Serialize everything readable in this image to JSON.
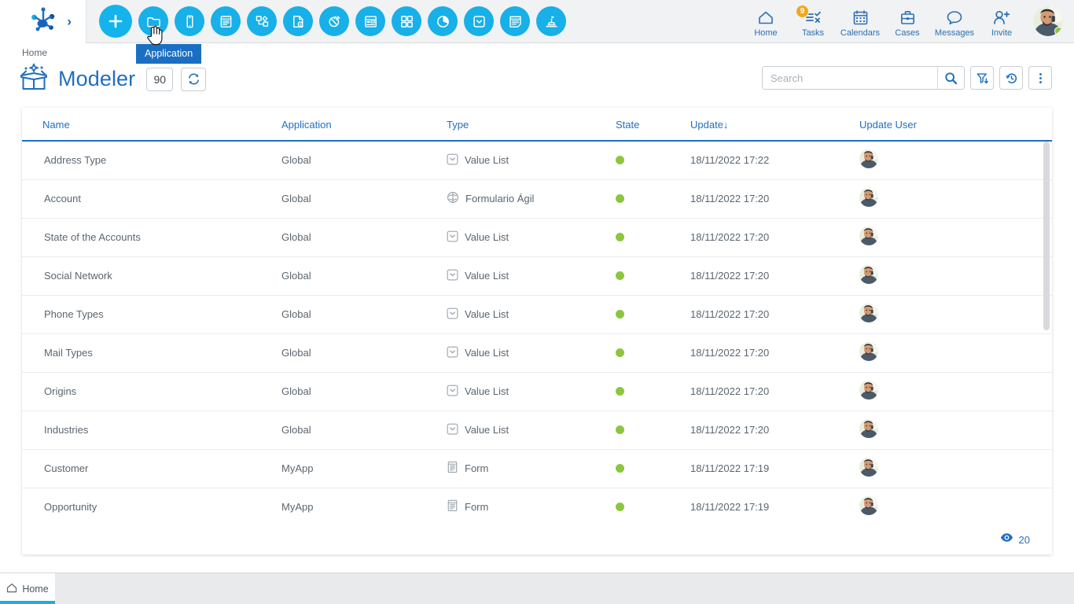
{
  "app": {
    "logo_name": "bizagi-logo",
    "expand_chevron": "›"
  },
  "toolbar": {
    "buttons": [
      {
        "name": "new-button",
        "icon": "plus-icon",
        "tooltip": "New"
      },
      {
        "name": "application-button",
        "icon": "folder-icon",
        "tooltip": "Application"
      },
      {
        "name": "mobile-button",
        "icon": "mobile-icon",
        "tooltip": "Mobile"
      },
      {
        "name": "form-button",
        "icon": "form-icon",
        "tooltip": "Form"
      },
      {
        "name": "process-button",
        "icon": "process-diagram-icon",
        "tooltip": "Process"
      },
      {
        "name": "document-template-button",
        "icon": "document-gear-icon",
        "tooltip": "Document Template"
      },
      {
        "name": "connector-button",
        "icon": "plug-icon",
        "tooltip": "Connector"
      },
      {
        "name": "layout-button",
        "icon": "page-layout-icon",
        "tooltip": "Layout"
      },
      {
        "name": "dashboard-button",
        "icon": "grid-squares-icon",
        "tooltip": "Dashboard"
      },
      {
        "name": "chart-button",
        "icon": "pie-chart-icon",
        "tooltip": "Chart"
      },
      {
        "name": "value-list-button",
        "icon": "value-list-icon",
        "tooltip": "Value List"
      },
      {
        "name": "report-button",
        "icon": "report-icon",
        "tooltip": "Report"
      },
      {
        "name": "business-rule-button",
        "icon": "rule-stamp-icon",
        "tooltip": "Business Rule"
      }
    ],
    "active_tooltip": "Application"
  },
  "topnav": {
    "items": [
      {
        "label": "Home",
        "icon": "home-icon",
        "badge": null
      },
      {
        "label": "Tasks",
        "icon": "tasks-checklist-icon",
        "badge": "9"
      },
      {
        "label": "Calendars",
        "icon": "calendar-icon",
        "badge": null
      },
      {
        "label": "Cases",
        "icon": "briefcase-icon",
        "badge": null
      },
      {
        "label": "Messages",
        "icon": "chat-bubble-icon",
        "badge": null
      },
      {
        "label": "Invite",
        "icon": "user-add-icon",
        "badge": null
      }
    ],
    "avatar_name": "user-avatar",
    "status": "online"
  },
  "page": {
    "breadcrumb": "Home",
    "title": "Modeler",
    "count": "90",
    "refresh_icon": "refresh-icon",
    "module_icon": "open-box-sparkle-icon"
  },
  "search": {
    "value": "",
    "placeholder": "Search",
    "search_icon": "magnifier-icon",
    "filter_icon": "filter-down-icon",
    "history_icon": "history-revert-icon",
    "more_icon": "kebab-menu-icon"
  },
  "table": {
    "columns": [
      {
        "key": "name",
        "label": "Name"
      },
      {
        "key": "application",
        "label": "Application"
      },
      {
        "key": "type",
        "label": "Type"
      },
      {
        "key": "state",
        "label": "State"
      },
      {
        "key": "update",
        "label": "Update",
        "sort": "↓"
      },
      {
        "key": "update_user",
        "label": "Update User"
      }
    ],
    "rows": [
      {
        "name": "Address Type",
        "application": "Global",
        "type": "Value List",
        "type_icon": "value-list-icon",
        "state": "active",
        "update": "18/11/2022 17:22",
        "user": "user-avatar"
      },
      {
        "name": "Account",
        "application": "Global",
        "type": "Formulario Ágil",
        "type_icon": "agile-form-icon",
        "state": "active",
        "update": "18/11/2022 17:20",
        "user": "user-avatar"
      },
      {
        "name": "State of the Accounts",
        "application": "Global",
        "type": "Value List",
        "type_icon": "value-list-icon",
        "state": "active",
        "update": "18/11/2022 17:20",
        "user": "user-avatar"
      },
      {
        "name": "Social Network",
        "application": "Global",
        "type": "Value List",
        "type_icon": "value-list-icon",
        "state": "active",
        "update": "18/11/2022 17:20",
        "user": "user-avatar"
      },
      {
        "name": "Phone Types",
        "application": "Global",
        "type": "Value List",
        "type_icon": "value-list-icon",
        "state": "active",
        "update": "18/11/2022 17:20",
        "user": "user-avatar"
      },
      {
        "name": "Mail Types",
        "application": "Global",
        "type": "Value List",
        "type_icon": "value-list-icon",
        "state": "active",
        "update": "18/11/2022 17:20",
        "user": "user-avatar"
      },
      {
        "name": "Origins",
        "application": "Global",
        "type": "Value List",
        "type_icon": "value-list-icon",
        "state": "active",
        "update": "18/11/2022 17:20",
        "user": "user-avatar"
      },
      {
        "name": "Industries",
        "application": "Global",
        "type": "Value List",
        "type_icon": "value-list-icon",
        "state": "active",
        "update": "18/11/2022 17:20",
        "user": "user-avatar"
      },
      {
        "name": "Customer",
        "application": "MyApp",
        "type": "Form",
        "type_icon": "form-doc-icon",
        "state": "active",
        "update": "18/11/2022 17:19",
        "user": "user-avatar"
      },
      {
        "name": "Opportunity",
        "application": "MyApp",
        "type": "Form",
        "type_icon": "form-doc-icon",
        "state": "active",
        "update": "18/11/2022 17:19",
        "user": "user-avatar"
      }
    ],
    "footer": {
      "visible_icon": "eye-icon",
      "visible_count": "20"
    }
  },
  "taskbar": {
    "tabs": [
      {
        "label": "Home",
        "icon": "home-outline-icon",
        "active": true
      }
    ]
  },
  "colors": {
    "accent_blue": "#1f6fc0",
    "icon_cyan": "#17b0e8",
    "status_green": "#8cc63e",
    "badge_orange": "#f0a81e",
    "header_bg": "#f1f2f3",
    "taskbar_bg": "#e9eaec"
  }
}
